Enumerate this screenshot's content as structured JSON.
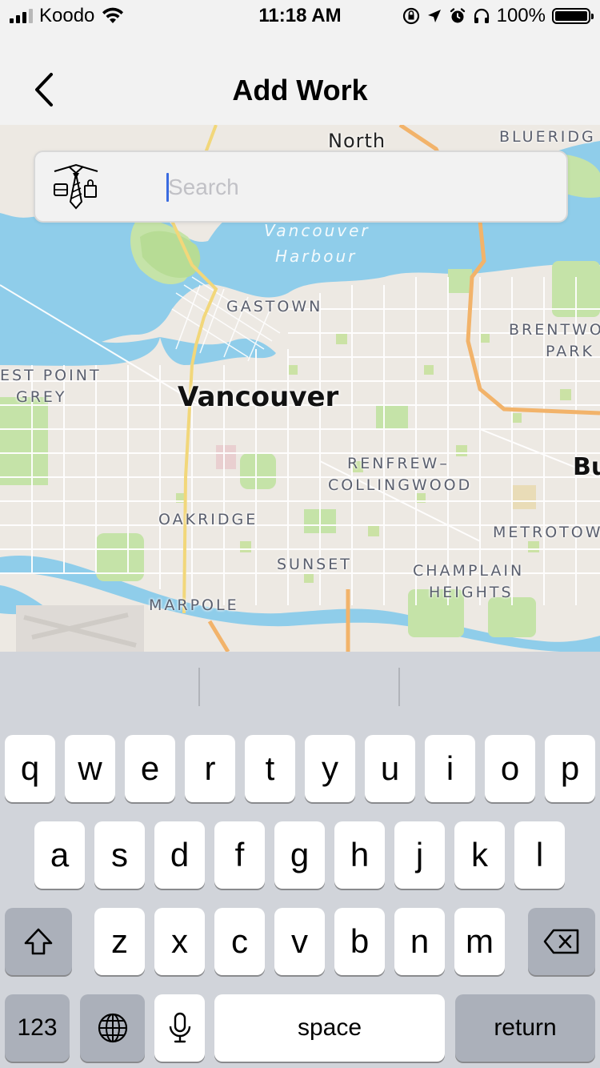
{
  "status_bar": {
    "carrier": "Koodo",
    "time": "11:18 AM",
    "battery": "100%"
  },
  "nav": {
    "title": "Add Work",
    "back_icon": "chevron-left-icon"
  },
  "search": {
    "placeholder": "Search",
    "value": "",
    "icon": "work-tie-icon"
  },
  "map": {
    "labels": {
      "north": "North",
      "blueridge": "BLUERIDG",
      "harbour_line1": "Vancouver",
      "harbour_line2": "Harbour",
      "gastown": "GASTOWN",
      "brentwood": "BRENTWO",
      "park": "PARK",
      "west_point": "EST POINT",
      "grey": "GREY",
      "city": "Vancouver",
      "renfrew": "RENFREW–",
      "collingwood": "COLLINGWOOD",
      "burnaby": "Bu",
      "oakridge": "OAKRIDGE",
      "metrotown": "METROTOW",
      "sunset": "SUNSET",
      "champlain": "CHAMPLAIN",
      "heights": "HEIGHTS",
      "marpole": "MARPOLE"
    },
    "colors": {
      "land": "#ede9e3",
      "water": "#8fcdea",
      "park": "#c5e3a8",
      "highway": "#f2b36a",
      "arterial": "#f2d77a"
    }
  },
  "keyboard": {
    "row1": [
      "q",
      "w",
      "e",
      "r",
      "t",
      "y",
      "u",
      "i",
      "o",
      "p"
    ],
    "row2": [
      "a",
      "s",
      "d",
      "f",
      "g",
      "h",
      "j",
      "k",
      "l"
    ],
    "row3": [
      "z",
      "x",
      "c",
      "v",
      "b",
      "n",
      "m"
    ],
    "shift_icon": "shift-arrow-icon",
    "delete_icon": "backspace-icon",
    "numbers_label": "123",
    "globe_icon": "globe-icon",
    "mic_icon": "microphone-icon",
    "space_label": "space",
    "return_label": "return"
  }
}
